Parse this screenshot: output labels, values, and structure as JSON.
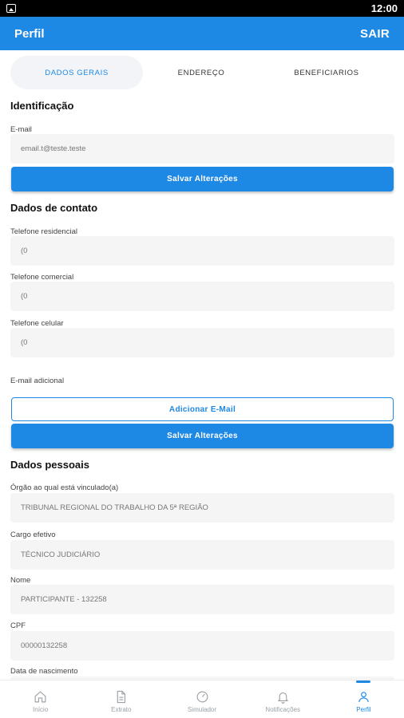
{
  "status": {
    "time": "12:00"
  },
  "appbar": {
    "title": "Perfil",
    "action": "SAIR"
  },
  "tabs": [
    "DADOS GERAIS",
    "ENDEREÇO",
    "BENEFICIARIOS"
  ],
  "identificacao": {
    "title": "Identificação",
    "email_label": "E-mail",
    "email_value": "email.t@teste.teste",
    "save_button": "Salvar Alterações"
  },
  "contato": {
    "title": "Dados de contato",
    "residencial_label": "Telefone residencial",
    "residencial_value": "(0",
    "comercial_label": "Telefone comercial",
    "comercial_value": "(0",
    "celular_label": "Telefone celular",
    "celular_value": "(0",
    "email_adicional_label": "E-mail adicional",
    "add_email_button": "Adicionar E-Mail",
    "save_button": "Salvar Alterações"
  },
  "pessoais": {
    "title": "Dados pessoais",
    "orgao_label": "Órgão ao qual está vinculado(a)",
    "orgao_value": "TRIBUNAL REGIONAL DO TRABALHO DA 5ª REGIÃO",
    "cargo_label": "Cargo efetivo",
    "cargo_value": "TÉCNICO JUDICIÁRIO",
    "nome_label": "Nome",
    "nome_value": "PARTICIPANTE - 132258",
    "cpf_label": "CPF",
    "cpf_value": "00000132258",
    "nascimento_label": "Data de nascimento"
  },
  "bottom_nav": [
    {
      "label": "Início",
      "icon": "home-icon"
    },
    {
      "label": "Extrato",
      "icon": "document-icon"
    },
    {
      "label": "Simulador",
      "icon": "gauge-icon"
    },
    {
      "label": "Notificações",
      "icon": "bell-icon"
    },
    {
      "label": "Perfil",
      "icon": "person-icon"
    }
  ],
  "colors": {
    "primary": "#1e88e5",
    "field_bg": "#f5f5f6"
  }
}
